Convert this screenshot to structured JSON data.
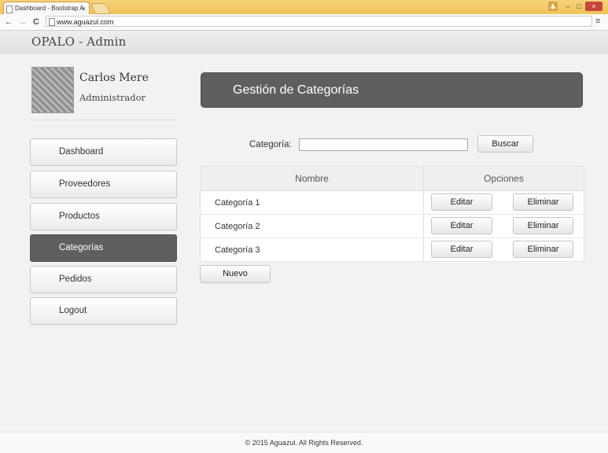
{
  "browser": {
    "tab_title": "Dashboard - Bootstrap A",
    "tab_close": "×",
    "address": "www.aguazul.com",
    "back": "←",
    "forward": "→",
    "reload": "C",
    "menu": "≡",
    "win_min": "–",
    "win_max": "□",
    "win_close": "×",
    "win_user": "♟"
  },
  "app": {
    "brand": "OPALO - Admin"
  },
  "user": {
    "name": "Carlos Mere",
    "role": "Administrador"
  },
  "sidebar": {
    "items": [
      {
        "label": "Dashboard",
        "active": false
      },
      {
        "label": "Proveedores",
        "active": false
      },
      {
        "label": "Productos",
        "active": false
      },
      {
        "label": "Categorías",
        "active": true
      },
      {
        "label": "Pedidos",
        "active": false
      },
      {
        "label": "Logout",
        "active": false
      }
    ]
  },
  "main": {
    "title": "Gestión de Categorías",
    "search_label": "Categoría:",
    "search_value": "",
    "search_button": "Buscar",
    "table": {
      "headers": [
        "Nombre",
        "Opciones"
      ],
      "rows": [
        {
          "name": "Categoría 1",
          "edit": "Editar",
          "delete": "Eliminar"
        },
        {
          "name": "Categoría 2",
          "edit": "Editar",
          "delete": "Eliminar"
        },
        {
          "name": "Categoría 3",
          "edit": "Editar",
          "delete": "Eliminar"
        }
      ]
    },
    "new_button": "Nuevo"
  },
  "footer": {
    "text": "© 2015 Aguazul. All Rights Reserved."
  },
  "colors": {
    "active": "#5f5f5f",
    "panel_header": "#5f5f5f",
    "chrome": "#f0c25a"
  }
}
